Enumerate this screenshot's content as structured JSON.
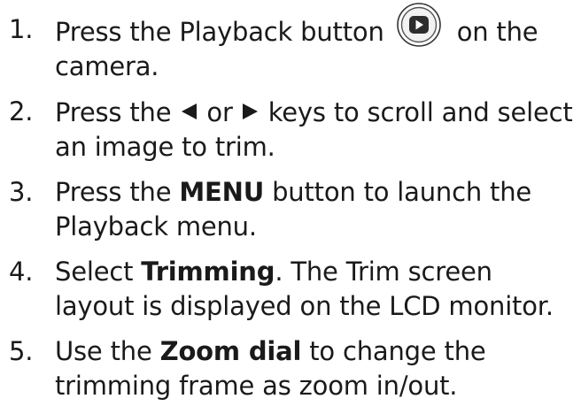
{
  "steps": [
    {
      "number": "1.",
      "text_before": "Press the Playback button",
      "icon": "playback-button-icon",
      "text_after": "on the camera."
    },
    {
      "number": "2.",
      "text_before": "Press the",
      "icon_left": "left-arrow-icon",
      "middle": "or",
      "icon_right": "right-arrow-icon",
      "text_after": "keys to scroll and select an image to trim."
    },
    {
      "number": "3.",
      "text_before": "Press the",
      "bold": "MENU",
      "text_after": "button to launch the Playback menu."
    },
    {
      "number": "4.",
      "text_before": "Select",
      "bold": "Trimming",
      "text_after": ". The Trim screen layout is displayed on the LCD monitor."
    },
    {
      "number": "5.",
      "text_before": "Use the",
      "bold": "Zoom dial",
      "text_after": "to change the trimming frame as zoom in/out."
    }
  ]
}
